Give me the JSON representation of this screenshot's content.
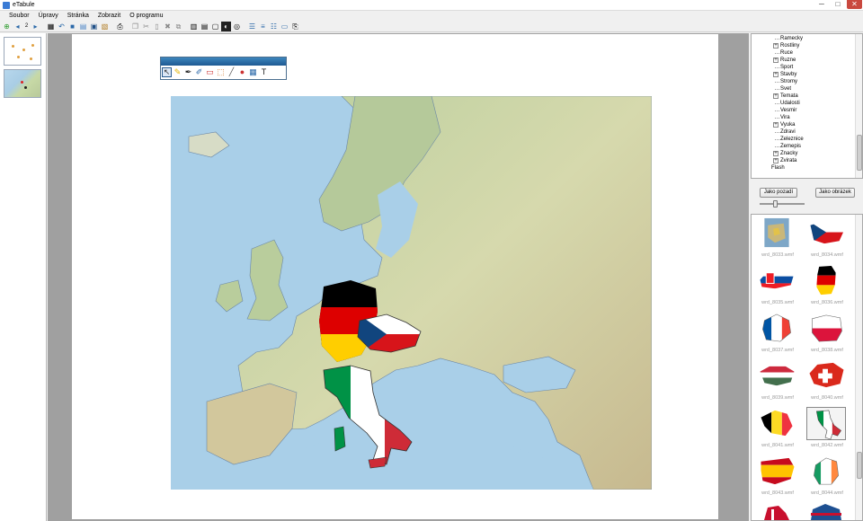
{
  "window": {
    "title": "eTabule",
    "minimize_label": "─",
    "maximize_label": "□",
    "close_label": "✕"
  },
  "menu": [
    "Soubor",
    "Úpravy",
    "Stránka",
    "Zobrazit",
    "O programu"
  ],
  "toolbar": {
    "page_number": "2",
    "icons": [
      "add-page-icon",
      "prev-page-icon",
      "page-number",
      "next-page-icon",
      "sep",
      "grid-icon",
      "undo-icon",
      "new-icon",
      "open-icon",
      "save-icon",
      "save-as-icon",
      "sep",
      "print-icon",
      "sep",
      "copy-icon",
      "cut-icon",
      "paste-icon",
      "delete-icon",
      "clone-icon",
      "sep",
      "bring-front-icon",
      "send-back-icon",
      "layer-icon",
      "screen-shade-icon",
      "spotlight-icon",
      "sep",
      "align-left-icon",
      "align-center-icon",
      "align-right-icon",
      "monitor-icon",
      "export-icon"
    ]
  },
  "draw_toolbar": {
    "tools": [
      {
        "name": "pointer-tool",
        "glyph": "↖",
        "active": true
      },
      {
        "name": "pencil-tool",
        "glyph": "✎"
      },
      {
        "name": "pen-tool",
        "glyph": "✒"
      },
      {
        "name": "marker-tool",
        "glyph": "✐"
      },
      {
        "name": "eraser-tool",
        "glyph": "▭"
      },
      {
        "name": "fill-tool",
        "glyph": "⬚"
      },
      {
        "name": "highlighter-tool",
        "glyph": "╱"
      },
      {
        "name": "shapes-tool",
        "glyph": "●"
      },
      {
        "name": "image-tool",
        "glyph": "▦"
      },
      {
        "name": "text-tool",
        "glyph": "T"
      }
    ]
  },
  "tree": {
    "items": [
      {
        "label": "Ramecky",
        "expandable": false
      },
      {
        "label": "Rostliny",
        "expandable": true
      },
      {
        "label": "Ruce",
        "expandable": false
      },
      {
        "label": "Ruzne",
        "expandable": true
      },
      {
        "label": "Sport",
        "expandable": false
      },
      {
        "label": "Stavby",
        "expandable": true
      },
      {
        "label": "Stromy",
        "expandable": false
      },
      {
        "label": "Svet",
        "expandable": false
      },
      {
        "label": "Temata",
        "expandable": true
      },
      {
        "label": "Udalosti",
        "expandable": false
      },
      {
        "label": "Vesmir",
        "expandable": false
      },
      {
        "label": "Vira",
        "expandable": false
      },
      {
        "label": "Vyuka",
        "expandable": true
      },
      {
        "label": "Zdravi",
        "expandable": false
      },
      {
        "label": "Zeleznice",
        "expandable": false
      },
      {
        "label": "Zemepis",
        "expandable": false
      },
      {
        "label": "Znacky",
        "expandable": true
      },
      {
        "label": "Zvirata",
        "expandable": true
      }
    ],
    "root_label": "Flash"
  },
  "actions": {
    "background_button": "Jako pozadí",
    "image_button": "Jako obrázek"
  },
  "gallery": [
    {
      "caption": "wrd_8033.wmf",
      "kind": "europe-map"
    },
    {
      "caption": "wrd_8034.wmf",
      "kind": "czech"
    },
    {
      "caption": "wrd_8035.wmf",
      "kind": "slovakia"
    },
    {
      "caption": "wrd_8036.wmf",
      "kind": "germany"
    },
    {
      "caption": "wrd_8037.wmf",
      "kind": "france"
    },
    {
      "caption": "wrd_8038.wmf",
      "kind": "poland"
    },
    {
      "caption": "wrd_8039.wmf",
      "kind": "hungary"
    },
    {
      "caption": "wrd_8040.wmf",
      "kind": "switzerland"
    },
    {
      "caption": "wrd_8041.wmf",
      "kind": "belgium"
    },
    {
      "caption": "wrd_8042.wmf",
      "kind": "italy",
      "selected": true
    },
    {
      "caption": "wrd_8043.wmf",
      "kind": "spain"
    },
    {
      "caption": "wrd_8044.wmf",
      "kind": "ireland"
    }
  ],
  "colors": {
    "sea": "#a9cfe8",
    "land": "#c9d8a8",
    "accent": "#2a68a8"
  }
}
